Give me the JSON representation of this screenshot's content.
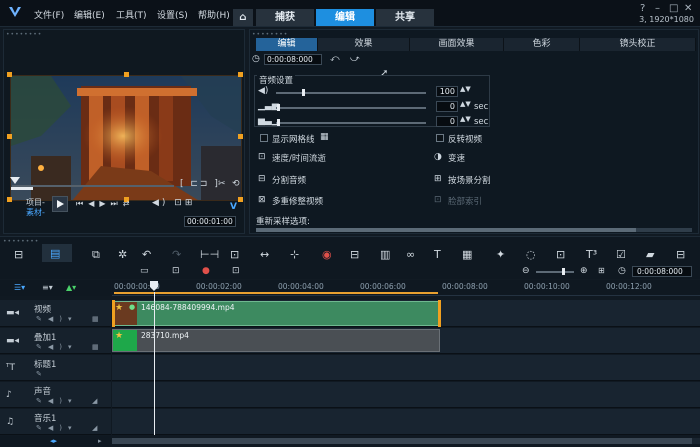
{
  "menu": {
    "file": "文件(F)",
    "edit": "编辑(E)",
    "tools": "工具(T)",
    "settings": "设置(S)",
    "help": "帮助(H)"
  },
  "main_tabs": {
    "capture": "捕获",
    "edit": "编辑",
    "share": "共享"
  },
  "resolution": "3, 1920*1080",
  "preview": {
    "project_label": "项目-",
    "clip_label": "素材-",
    "timecode": "00:00:01:00",
    "zoom_label": "V"
  },
  "options": {
    "tabs": [
      "编辑",
      "效果",
      "画面效果",
      "色彩",
      "镜头校正"
    ],
    "duration": "0:00:08:000",
    "audio_section": "音频设置",
    "volume": "100",
    "fade_in": "0",
    "fade_out": "0",
    "sec": "sec",
    "show_grid": "显示网格线",
    "reverse": "反转视频",
    "speed_time": "速度/时间流逝",
    "speed": "变速",
    "split_audio": "分割音频",
    "split_scene": "按场景分割",
    "multi_trim": "多重修整视频",
    "face_index": "脸部索引",
    "resample": "重新采样选项:"
  },
  "toolbar": {
    "timecode": "0:00:08:000"
  },
  "timeline": {
    "ruler": [
      "00:00:00:00",
      "00:00:02:00",
      "00:00:04:00",
      "00:00:06:00",
      "00:00:08:00",
      "00:00:10:00",
      "00:00:12:00"
    ],
    "tracks": {
      "video": "视频",
      "overlay": "叠加1",
      "title": "标题1",
      "voice": "声音",
      "music": "音乐1"
    },
    "clips": {
      "video": "146084-788409994.mp4",
      "overlay": "283710.mp4"
    }
  },
  "colors": {
    "accent": "#1e8fe0",
    "clip_green": "#3a8a5a",
    "clip_gray": "#4a4f54"
  }
}
